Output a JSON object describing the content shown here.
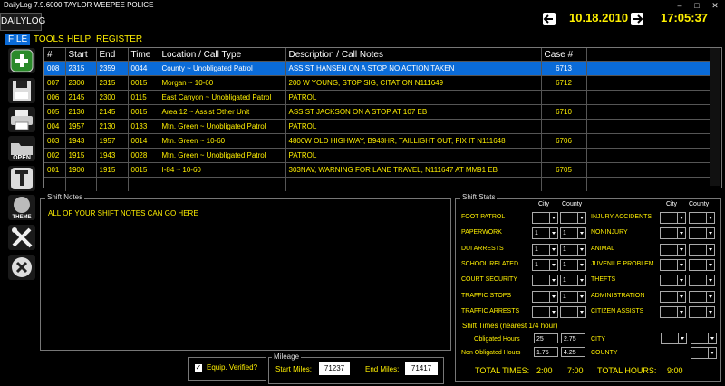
{
  "window": {
    "title": "DailyLog 7.9.6000  TAYLOR  WEEPEE POLICE"
  },
  "app_tab": "DAILYLOG",
  "header": {
    "date": "10.18.2010",
    "time": "17:05:37"
  },
  "menu": [
    "FILE",
    "TOOLS",
    "HELP",
    "REGISTER"
  ],
  "toolbar": [
    "add-icon",
    "save-icon",
    "print-icon",
    "open-icon",
    "text-icon",
    "theme-icon",
    "tools-icon",
    "close-icon"
  ],
  "toolbar_labels": {
    "open": "OPEN",
    "theme": "THEME"
  },
  "log": {
    "columns": [
      "#",
      "Start",
      "End",
      "Time",
      "Location / Call Type",
      "Description / Call Notes",
      "Case #"
    ],
    "rows": [
      [
        "008",
        "2315",
        "2359",
        "0044",
        "County ~ Unobligated Patrol",
        "ASSIST HANSEN ON A STOP NO ACTION TAKEN",
        "6713"
      ],
      [
        "007",
        "2300",
        "2315",
        "0015",
        "Morgan ~ 10-60",
        "200 W YOUNG, STOP SIG, CITATION N111649",
        "6712"
      ],
      [
        "006",
        "2145",
        "2300",
        "0115",
        "East Canyon ~ Unobligated Patrol",
        "PATROL",
        ""
      ],
      [
        "005",
        "2130",
        "2145",
        "0015",
        "Area 12 ~ Assist Other Unit",
        "ASSIST JACKSON ON A STOP AT 107 EB",
        "6710"
      ],
      [
        "004",
        "1957",
        "2130",
        "0133",
        "Mtn. Green ~ Unobligated Patrol",
        "PATROL",
        ""
      ],
      [
        "003",
        "1943",
        "1957",
        "0014",
        "Mtn. Green ~ 10-60",
        "4800W OLD HIGHWAY, B943HR, TAILLIGHT OUT, FIX IT N111648",
        "6706"
      ],
      [
        "002",
        "1915",
        "1943",
        "0028",
        "Mtn. Green ~ Unobligated Patrol",
        "PATROL",
        ""
      ],
      [
        "001",
        "1900",
        "1915",
        "0015",
        "I-84 ~ 10-60",
        "303NAV, WARNING FOR LANE TRAVEL, N111647 AT MM91 EB",
        "6705"
      ]
    ]
  },
  "notes": {
    "label": "Shift Notes",
    "text": "ALL OF YOUR SHIFT NOTES CAN GO HERE"
  },
  "stats": {
    "label": "Shift Stats",
    "col_city": "City",
    "col_county": "County",
    "left": [
      {
        "label": "FOOT PATROL",
        "city": "",
        "county": ""
      },
      {
        "label": "PAPERWORK",
        "city": "1",
        "county": "1"
      },
      {
        "label": "DUI ARRESTS",
        "city": "1",
        "county": "1"
      },
      {
        "label": "SCHOOL RELATED",
        "city": "1",
        "county": "1"
      },
      {
        "label": "COURT SECURITY",
        "city": "",
        "county": "1"
      },
      {
        "label": "TRAFFIC STOPS",
        "city": "",
        "county": "1"
      },
      {
        "label": "TRAFFIC ARRESTS",
        "city": "",
        "county": ""
      }
    ],
    "right": [
      {
        "label": "INJURY ACCIDENTS",
        "city": "",
        "county": ""
      },
      {
        "label": "NONINJURY",
        "city": "",
        "county": ""
      },
      {
        "label": "ANIMAL",
        "city": "",
        "county": ""
      },
      {
        "label": "JUVENILE PROBLEM",
        "city": "",
        "county": ""
      },
      {
        "label": "THEFTS",
        "city": "",
        "county": ""
      },
      {
        "label": "ADMINISTRATION",
        "city": "",
        "county": ""
      },
      {
        "label": "CITIZEN ASSISTS",
        "city": "",
        "county": ""
      }
    ],
    "times_label": "Shift Times (nearest 1/4 hour)",
    "obligated_label": "Obligated Hours",
    "obligated": [
      "25",
      "2.75"
    ],
    "nonobligated_label": "Non Obligated Hours",
    "nonobligated": [
      "1.75",
      "4.25"
    ],
    "city_label": "CITY",
    "county_label": "COUNTY",
    "total_times_label": "TOTAL TIMES:",
    "total_a": "2:00",
    "total_b": "7:00",
    "total_hours_label": "TOTAL HOURS:",
    "total_hours": "9:00"
  },
  "equip": {
    "label": "Equip. Verified?",
    "checked": true
  },
  "mileage": {
    "label": "Mileage",
    "start_label": "Start Miles:",
    "start": "71237",
    "end_label": "End Miles:",
    "end": "71417"
  }
}
